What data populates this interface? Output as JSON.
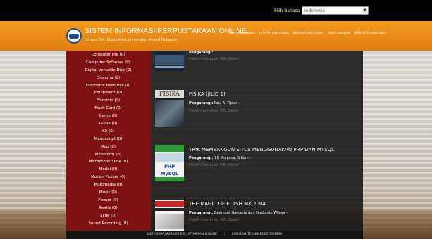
{
  "language": {
    "label": "Pilih Bahasa",
    "selected": "Indonesia"
  },
  "header": {
    "title": "SISTEM INFORMASI PERPUSTAKAAN ONLINE",
    "subtitle": "Jurusan Tek. Elektronika Universitas Negeri Makassar",
    "nav": [
      "Beranda depan",
      "Info Perpustakaan",
      "Bantuan pencarian",
      "Area Anggota",
      "MASUK Pustakawan"
    ]
  },
  "sidebar": {
    "items": [
      "Computer File (0)",
      "Computer Software (0)",
      "Digital Versatile Disc (0)",
      "Diorama (0)",
      "Electronic Resource (0)",
      "Equipment (0)",
      "Filmstrip (0)",
      "Flash Card (0)",
      "Game (0)",
      "Globe (0)",
      "Kit (0)",
      "Manuscript (0)",
      "Map (0)",
      "Microform (0)",
      "Microscope Slide (0)",
      "Model (0)",
      "Motion Picture (0)",
      "Multimedia (0)",
      "Music (0)",
      "Picture (0)",
      "Realia (0)",
      "Slide (0)",
      "Sound Recording (0)"
    ]
  },
  "books": [
    {
      "title": "",
      "author_label": "Pengarang :",
      "author": "",
      "links": "Detail Cantuman XML Detail"
    },
    {
      "title": "FISIKA (JILID 1)",
      "author_label": "Pengarang :",
      "author": "Paul A. Tipler -",
      "links": "Detail Cantuman XML Detail",
      "cover_text": "FISIKA"
    },
    {
      "title": "TRIK MEMBANGUN SITUS MENGGUNAKAN PHP DAN MYSQL",
      "author_label": "Pengarang :",
      "author": "Y.B Mulyana, S.Kom -",
      "links": "Detail Cantuman XML Detail",
      "cover_text": "PHP MySQL"
    },
    {
      "title": "THE MAGIC OF FLASH MX 2004",
      "author_label": "Pengarang :",
      "author": "Beernard Hartanto dan Ferdianto Wijaya -",
      "links": "Detail Cantuman XML Detail"
    }
  ],
  "footer": {
    "left": "SISTEM INFORMASI PERPUSTAKAAN ONLINE",
    "right": "JURUSAN TEKNIK ELEKTRONIKA"
  },
  "colors": {
    "header": "#e88a15",
    "sidebar": "#7e1212",
    "topbar": "#000000",
    "content": "#141414"
  }
}
